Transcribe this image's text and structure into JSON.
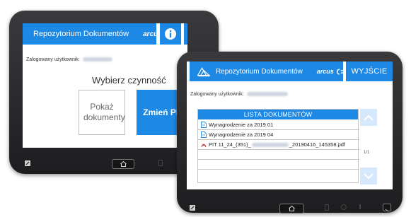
{
  "app": {
    "title": "Repozytorium Dokumentów",
    "brand": "arcus"
  },
  "screen1": {
    "logged_label": "Zalogowany użytkownik:",
    "prompt": "Wybierz czynność",
    "buttons": {
      "show_docs": "Pokaż dokumenty",
      "change_pin": "Zmień PIN"
    }
  },
  "screen2": {
    "logged_label": "Zalogowany użytkownik:",
    "exit": "WYJŚCIE",
    "list_header": "LISTA DOKUMENTÓW",
    "documents": [
      "Wynagrodzenie za 2019 01",
      "Wynagrodzenie za 2019 04",
      "PIT 11_24_(351)_",
      "_20190416_145358.pdf"
    ],
    "page_indicator": "1/1"
  },
  "colors": {
    "accent": "#1e88e5",
    "bezel": "#2a2a2c",
    "pdf_red": "#d32f2f"
  },
  "icons": [
    "repository-logo-icon",
    "info-icon",
    "logout-icon",
    "home-icon",
    "chevron-up-icon",
    "chevron-down-icon",
    "document-icon",
    "pdf-icon"
  ]
}
